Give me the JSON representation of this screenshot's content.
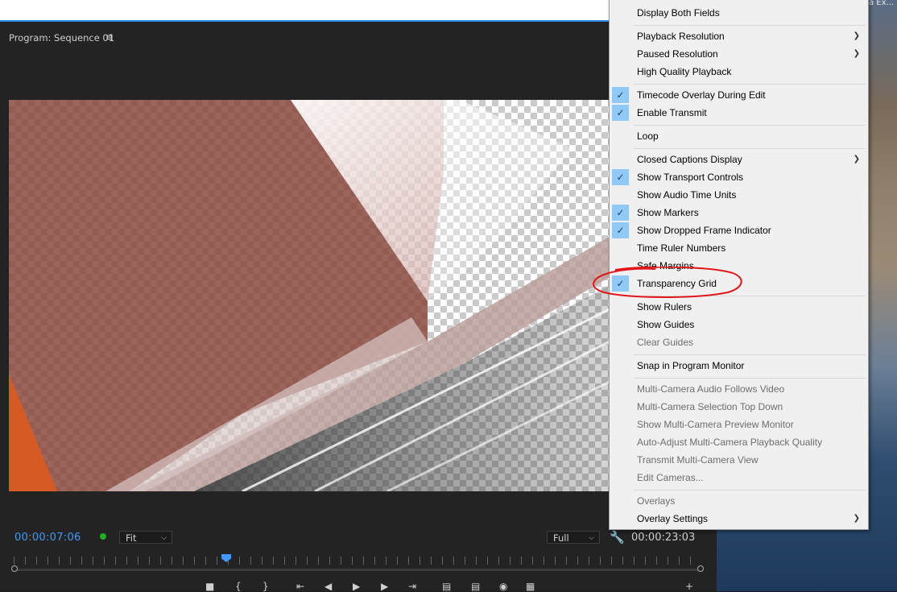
{
  "panel": {
    "title": "Program: Sequence 01",
    "menu_icon": "≡"
  },
  "side_photo_text": "a Ex...",
  "controls": {
    "timecode_current": "00:00:07:06",
    "zoom": {
      "selected": "Fit"
    },
    "resolution": {
      "selected": "Full"
    },
    "timecode_duration": "00:00:23:03"
  },
  "menu": {
    "items": [
      {
        "label": "Display Both Fields",
        "checked": false,
        "disabled": false,
        "submenu": false
      },
      {
        "label": "Playback Resolution",
        "checked": false,
        "disabled": false,
        "submenu": true
      },
      {
        "label": "Paused Resolution",
        "checked": false,
        "disabled": false,
        "submenu": true
      },
      {
        "label": "High Quality Playback",
        "checked": false,
        "disabled": false,
        "submenu": false
      },
      {
        "label": "Timecode Overlay During Edit",
        "checked": true,
        "disabled": false,
        "submenu": false
      },
      {
        "label": "Enable Transmit",
        "checked": true,
        "disabled": false,
        "submenu": false
      },
      {
        "label": "Loop",
        "checked": false,
        "disabled": false,
        "submenu": false
      },
      {
        "label": "Closed Captions Display",
        "checked": false,
        "disabled": false,
        "submenu": true
      },
      {
        "label": "Show Transport Controls",
        "checked": true,
        "disabled": false,
        "submenu": false
      },
      {
        "label": "Show Audio Time Units",
        "checked": false,
        "disabled": false,
        "submenu": false
      },
      {
        "label": "Show Markers",
        "checked": true,
        "disabled": false,
        "submenu": false
      },
      {
        "label": "Show Dropped Frame Indicator",
        "checked": true,
        "disabled": false,
        "submenu": false
      },
      {
        "label": "Time Ruler Numbers",
        "checked": false,
        "disabled": false,
        "submenu": false
      },
      {
        "label": "Safe Margins",
        "checked": false,
        "disabled": false,
        "submenu": false
      },
      {
        "label": "Transparency Grid",
        "checked": true,
        "disabled": false,
        "submenu": false
      },
      {
        "label": "Show Rulers",
        "checked": false,
        "disabled": false,
        "submenu": false
      },
      {
        "label": "Show Guides",
        "checked": false,
        "disabled": false,
        "submenu": false
      },
      {
        "label": "Clear Guides",
        "checked": false,
        "disabled": true,
        "submenu": false
      },
      {
        "label": "Snap in Program Monitor",
        "checked": false,
        "disabled": false,
        "submenu": false
      },
      {
        "label": "Multi-Camera Audio Follows Video",
        "checked": false,
        "disabled": true,
        "submenu": false
      },
      {
        "label": "Multi-Camera Selection Top Down",
        "checked": false,
        "disabled": true,
        "submenu": false
      },
      {
        "label": "Show Multi-Camera Preview Monitor",
        "checked": false,
        "disabled": true,
        "submenu": false
      },
      {
        "label": "Auto-Adjust Multi-Camera Playback Quality",
        "checked": false,
        "disabled": true,
        "submenu": false
      },
      {
        "label": "Transmit Multi-Camera View",
        "checked": false,
        "disabled": true,
        "submenu": false
      },
      {
        "label": "Edit Cameras...",
        "checked": false,
        "disabled": true,
        "submenu": false
      },
      {
        "label": "Overlays",
        "checked": false,
        "disabled": true,
        "submenu": false
      },
      {
        "label": "Overlay Settings",
        "checked": false,
        "disabled": false,
        "submenu": true
      }
    ]
  },
  "colors": {
    "accent": "#3d9bff",
    "check_highlight": "#90c8f6",
    "annotation": "#e0161b"
  }
}
